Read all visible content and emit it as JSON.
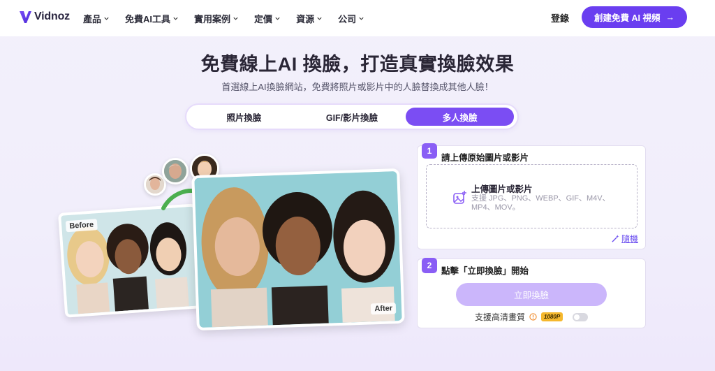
{
  "brand": {
    "name": "Vidnoz",
    "accent": "#6a3ef0"
  },
  "nav": {
    "items": [
      {
        "label": "產品"
      },
      {
        "label": "免費AI工具"
      },
      {
        "label": "實用案例"
      },
      {
        "label": "定價"
      },
      {
        "label": "資源"
      },
      {
        "label": "公司"
      }
    ],
    "login": "登錄",
    "cta": "創建免費 AI 視頻",
    "cta_arrow": "→"
  },
  "hero": {
    "title": "免費線上AI 換臉，打造真實換臉效果",
    "subtitle": "首選線上AI換臉網站，免費將照片或影片中的人臉替換成其他人臉！"
  },
  "tabs": [
    {
      "label": "照片換臉",
      "active": false
    },
    {
      "label": "GIF/影片換臉",
      "active": false
    },
    {
      "label": "多人換臉",
      "active": true
    }
  ],
  "illustration": {
    "before_label": "Before",
    "after_label": "After"
  },
  "step1": {
    "number": "1",
    "title": "請上傳原始圖片或影片",
    "upload_title": "上傳圖片或影片",
    "upload_formats": "支援 JPG、PNG、WEBP、GIF、M4V、MP4、MOV。",
    "random_link": "隨機"
  },
  "step2": {
    "number": "2",
    "title": "點擊「立即換臉」開始",
    "swap_button": "立即換臉",
    "hd_label": "支援高清畫質",
    "hd_badge": "1080P",
    "hd_enabled": false
  }
}
